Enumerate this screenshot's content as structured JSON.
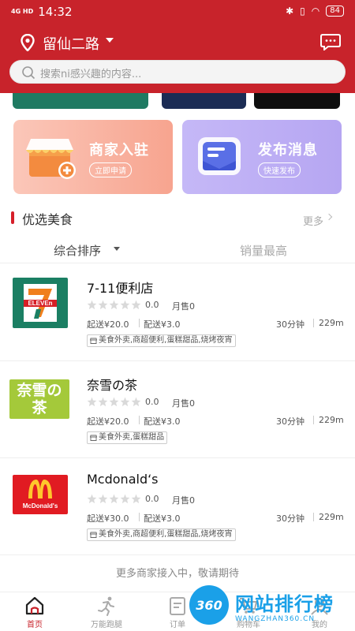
{
  "status_bar": {
    "network": "4G HD",
    "time": "14:32",
    "battery": "84"
  },
  "header": {
    "location": "留仙二路",
    "search_placeholder": "搜索ni感兴趣的内容..."
  },
  "promos": [
    {
      "title": "商家入驻",
      "tag": "立即申请",
      "icon": "shop-plus-icon"
    },
    {
      "title": "发布消息",
      "tag": "快速发布",
      "icon": "envelope-icon"
    }
  ],
  "section": {
    "title": "优选美食",
    "more": "更多"
  },
  "sort": {
    "default": "综合排序",
    "sales": "销量最高"
  },
  "shops": [
    {
      "name": "7-11便利店",
      "rating": "0.0",
      "sold": "月售0",
      "min_order": "起送¥20.0",
      "delivery": "配送¥3.0",
      "time": "30分钟",
      "distance": "229m",
      "tags": "美食外卖,商超便利,蛋糕甜品,烧烤夜宵",
      "logo": "seven-eleven-logo"
    },
    {
      "name": "奈雪の茶",
      "rating": "0.0",
      "sold": "月售0",
      "min_order": "起送¥20.0",
      "delivery": "配送¥3.0",
      "time": "30分钟",
      "distance": "229m",
      "tags": "美食外卖,蛋糕甜品",
      "logo": "naixue-logo",
      "logo_text": "奈雪の茶"
    },
    {
      "name": "Mcdonald‘s",
      "rating": "0.0",
      "sold": "月售0",
      "min_order": "起送¥30.0",
      "delivery": "配送¥3.0",
      "time": "30分钟",
      "distance": "229m",
      "tags": "美食外卖,商超便利,蛋糕甜品,烧烤夜宵",
      "logo": "mcdonalds-logo",
      "logo_text": "McDonald's"
    }
  ],
  "footer_note": "更多商家接入中，敬请期待",
  "nav": [
    {
      "label": "首页",
      "icon": "home-icon",
      "active": true
    },
    {
      "label": "万能跑腿",
      "icon": "runner-icon"
    },
    {
      "label": "订单",
      "icon": "order-icon"
    },
    {
      "label": "购物车",
      "icon": "cart-icon"
    },
    {
      "label": "我的",
      "icon": "user-icon"
    }
  ],
  "watermark": {
    "circle": "360",
    "cn": "网站排行榜",
    "en": "WANGZHAN360.CN"
  },
  "colors": {
    "brand_red": "#c8232b",
    "promo_orange": "#f7a48f",
    "promo_purple": "#b6a6f2"
  }
}
